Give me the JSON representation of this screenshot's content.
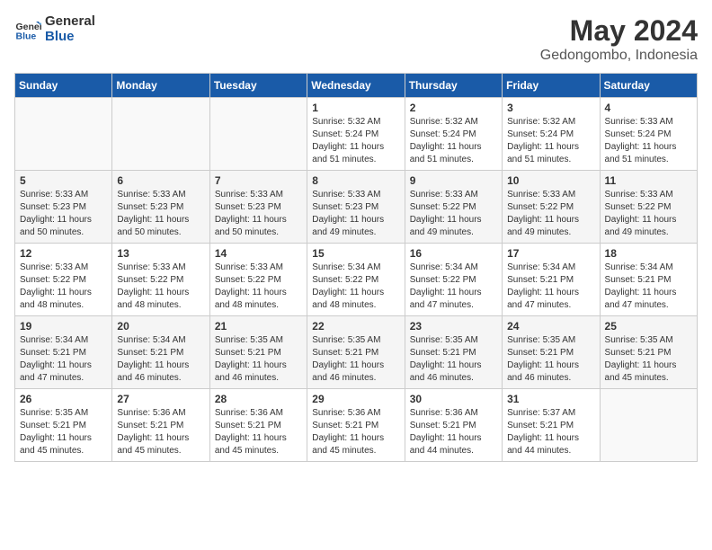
{
  "logo": {
    "line1": "General",
    "line2": "Blue"
  },
  "header": {
    "month": "May 2024",
    "location": "Gedongombo, Indonesia"
  },
  "days_of_week": [
    "Sunday",
    "Monday",
    "Tuesday",
    "Wednesday",
    "Thursday",
    "Friday",
    "Saturday"
  ],
  "weeks": [
    [
      {
        "day": "",
        "info": ""
      },
      {
        "day": "",
        "info": ""
      },
      {
        "day": "",
        "info": ""
      },
      {
        "day": "1",
        "info": "Sunrise: 5:32 AM\nSunset: 5:24 PM\nDaylight: 11 hours\nand 51 minutes."
      },
      {
        "day": "2",
        "info": "Sunrise: 5:32 AM\nSunset: 5:24 PM\nDaylight: 11 hours\nand 51 minutes."
      },
      {
        "day": "3",
        "info": "Sunrise: 5:32 AM\nSunset: 5:24 PM\nDaylight: 11 hours\nand 51 minutes."
      },
      {
        "day": "4",
        "info": "Sunrise: 5:33 AM\nSunset: 5:24 PM\nDaylight: 11 hours\nand 51 minutes."
      }
    ],
    [
      {
        "day": "5",
        "info": "Sunrise: 5:33 AM\nSunset: 5:23 PM\nDaylight: 11 hours\nand 50 minutes."
      },
      {
        "day": "6",
        "info": "Sunrise: 5:33 AM\nSunset: 5:23 PM\nDaylight: 11 hours\nand 50 minutes."
      },
      {
        "day": "7",
        "info": "Sunrise: 5:33 AM\nSunset: 5:23 PM\nDaylight: 11 hours\nand 50 minutes."
      },
      {
        "day": "8",
        "info": "Sunrise: 5:33 AM\nSunset: 5:23 PM\nDaylight: 11 hours\nand 49 minutes."
      },
      {
        "day": "9",
        "info": "Sunrise: 5:33 AM\nSunset: 5:22 PM\nDaylight: 11 hours\nand 49 minutes."
      },
      {
        "day": "10",
        "info": "Sunrise: 5:33 AM\nSunset: 5:22 PM\nDaylight: 11 hours\nand 49 minutes."
      },
      {
        "day": "11",
        "info": "Sunrise: 5:33 AM\nSunset: 5:22 PM\nDaylight: 11 hours\nand 49 minutes."
      }
    ],
    [
      {
        "day": "12",
        "info": "Sunrise: 5:33 AM\nSunset: 5:22 PM\nDaylight: 11 hours\nand 48 minutes."
      },
      {
        "day": "13",
        "info": "Sunrise: 5:33 AM\nSunset: 5:22 PM\nDaylight: 11 hours\nand 48 minutes."
      },
      {
        "day": "14",
        "info": "Sunrise: 5:33 AM\nSunset: 5:22 PM\nDaylight: 11 hours\nand 48 minutes."
      },
      {
        "day": "15",
        "info": "Sunrise: 5:34 AM\nSunset: 5:22 PM\nDaylight: 11 hours\nand 48 minutes."
      },
      {
        "day": "16",
        "info": "Sunrise: 5:34 AM\nSunset: 5:22 PM\nDaylight: 11 hours\nand 47 minutes."
      },
      {
        "day": "17",
        "info": "Sunrise: 5:34 AM\nSunset: 5:21 PM\nDaylight: 11 hours\nand 47 minutes."
      },
      {
        "day": "18",
        "info": "Sunrise: 5:34 AM\nSunset: 5:21 PM\nDaylight: 11 hours\nand 47 minutes."
      }
    ],
    [
      {
        "day": "19",
        "info": "Sunrise: 5:34 AM\nSunset: 5:21 PM\nDaylight: 11 hours\nand 47 minutes."
      },
      {
        "day": "20",
        "info": "Sunrise: 5:34 AM\nSunset: 5:21 PM\nDaylight: 11 hours\nand 46 minutes."
      },
      {
        "day": "21",
        "info": "Sunrise: 5:35 AM\nSunset: 5:21 PM\nDaylight: 11 hours\nand 46 minutes."
      },
      {
        "day": "22",
        "info": "Sunrise: 5:35 AM\nSunset: 5:21 PM\nDaylight: 11 hours\nand 46 minutes."
      },
      {
        "day": "23",
        "info": "Sunrise: 5:35 AM\nSunset: 5:21 PM\nDaylight: 11 hours\nand 46 minutes."
      },
      {
        "day": "24",
        "info": "Sunrise: 5:35 AM\nSunset: 5:21 PM\nDaylight: 11 hours\nand 46 minutes."
      },
      {
        "day": "25",
        "info": "Sunrise: 5:35 AM\nSunset: 5:21 PM\nDaylight: 11 hours\nand 45 minutes."
      }
    ],
    [
      {
        "day": "26",
        "info": "Sunrise: 5:35 AM\nSunset: 5:21 PM\nDaylight: 11 hours\nand 45 minutes."
      },
      {
        "day": "27",
        "info": "Sunrise: 5:36 AM\nSunset: 5:21 PM\nDaylight: 11 hours\nand 45 minutes."
      },
      {
        "day": "28",
        "info": "Sunrise: 5:36 AM\nSunset: 5:21 PM\nDaylight: 11 hours\nand 45 minutes."
      },
      {
        "day": "29",
        "info": "Sunrise: 5:36 AM\nSunset: 5:21 PM\nDaylight: 11 hours\nand 45 minutes."
      },
      {
        "day": "30",
        "info": "Sunrise: 5:36 AM\nSunset: 5:21 PM\nDaylight: 11 hours\nand 44 minutes."
      },
      {
        "day": "31",
        "info": "Sunrise: 5:37 AM\nSunset: 5:21 PM\nDaylight: 11 hours\nand 44 minutes."
      },
      {
        "day": "",
        "info": ""
      }
    ]
  ]
}
